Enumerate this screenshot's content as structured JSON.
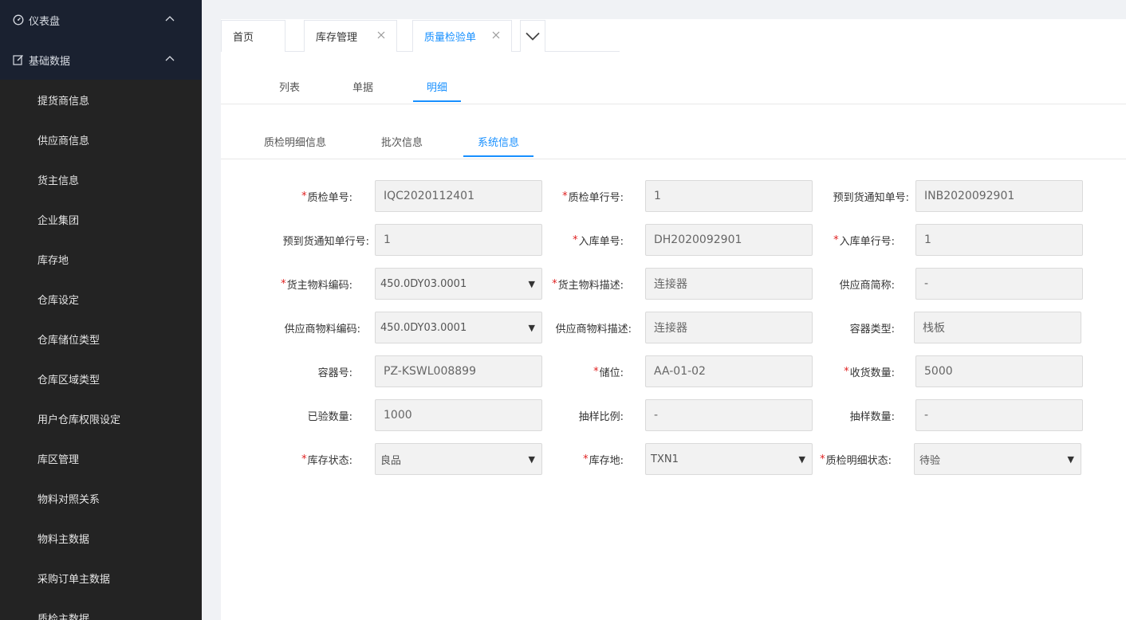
{
  "sidebar": {
    "groups": [
      {
        "label": "仪表盘",
        "icon": "dashboard-icon"
      },
      {
        "label": "基础数据",
        "icon": "edit-icon"
      }
    ],
    "items": [
      "提货商信息",
      "供应商信息",
      "货主信息",
      "企业集团",
      "库存地",
      "仓库设定",
      "仓库储位类型",
      "仓库区域类型",
      "用户仓库权限设定",
      "库区管理",
      "物料对照关系",
      "物料主数据",
      "采购订单主数据",
      "质检主数据"
    ]
  },
  "page_tabs": [
    "首页",
    "库存管理",
    "质量检验单"
  ],
  "sub_tabs": [
    "列表",
    "单据",
    "明细"
  ],
  "detail_tabs": [
    "质检明细信息",
    "批次信息",
    "系统信息"
  ],
  "form": {
    "f1": {
      "label": "质检单号:",
      "value": "IQC2020112401"
    },
    "f2": {
      "label": "质检单行号:",
      "value": "1"
    },
    "f3": {
      "label": "预到货通知单号:",
      "value": "INB2020092901"
    },
    "f4": {
      "label": "预到货通知单行号:",
      "value": "1"
    },
    "f5": {
      "label": "入库单号:",
      "value": "DH2020092901"
    },
    "f6": {
      "label": "入库单行号:",
      "value": "1"
    },
    "f7": {
      "label": "货主物料编码:",
      "value": "450.0DY03.0001"
    },
    "f8": {
      "label": "货主物料描述:",
      "value": "连接器"
    },
    "f9": {
      "label": "供应商简称:",
      "value": "-"
    },
    "f10": {
      "label": "供应商物料编码:",
      "value": "450.0DY03.0001"
    },
    "f11": {
      "label": "供应商物料描述:",
      "value": "连接器"
    },
    "f12": {
      "label": "容器类型:",
      "value": "栈板"
    },
    "f13": {
      "label": "容器号:",
      "value": "PZ-KSWL008899"
    },
    "f14": {
      "label": "储位:",
      "value": "AA-01-02"
    },
    "f15": {
      "label": "收货数量:",
      "value": "5000"
    },
    "f16": {
      "label": "已验数量:",
      "value": "1000"
    },
    "f17": {
      "label": "抽样比例:",
      "value": "-"
    },
    "f18": {
      "label": "抽样数量:",
      "value": "-"
    },
    "f19": {
      "label": "库存状态:",
      "value": "良品"
    },
    "f20": {
      "label": "库存地:",
      "value": "TXN1"
    },
    "f21": {
      "label": "质检明细状态:",
      "value": "待验"
    }
  },
  "required_mark": "*",
  "select_caret": "▼",
  "colors": {
    "accent": "#1890ff",
    "required": "#e02020",
    "sidebar_bg": "#232323",
    "sidebar_group_bg": "#1a2130"
  }
}
